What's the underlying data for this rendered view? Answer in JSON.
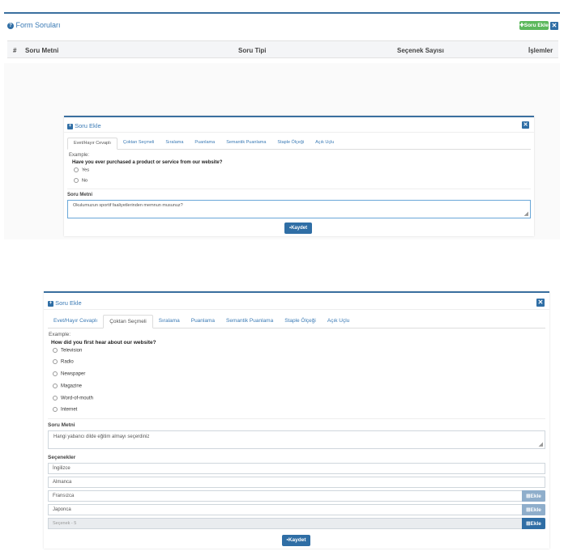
{
  "colors": {
    "accent": "#2f6ea5",
    "success": "#5cb85c",
    "panel_border": "#3a6f9f"
  },
  "form_panel": {
    "title": "Form Soruları",
    "title_icon": "question-circle-icon",
    "add_button": "Soru Ekle",
    "columns": [
      "#",
      "Soru Metni",
      "Soru Tipi",
      "Seçenek Sayısı",
      "İşlemler"
    ]
  },
  "modal1": {
    "title": "Soru Ekle",
    "tabs": [
      "Evet/Hayır Cevaplı",
      "Çoktan Seçmeli",
      "Sıralama",
      "Puanlama",
      "Semantik Puanlama",
      "Staple Ölçeği",
      "Açık Uçlu"
    ],
    "active_tab": 0,
    "example_label": "Example:",
    "example_question": "Have you ever purchased a product or service from our website?",
    "options": [
      "Yes",
      "No"
    ],
    "soru_metni_label": "Soru Metni",
    "soru_metni_value": "Okulumuzun sportif faaliyetlerinden memnun musunuz?",
    "save": "Kaydet"
  },
  "modal2": {
    "title": "Soru Ekle",
    "tabs": [
      "Evet/Hayır Cevaplı",
      "Çoktan Seçmeli",
      "Sıralama",
      "Puanlama",
      "Semantik Puanlama",
      "Staple Ölçeği",
      "Açık Uçlu"
    ],
    "active_tab": 1,
    "example_label": "Example:",
    "example_question": "How did you first hear about our website?",
    "options": [
      "Television",
      "Radio",
      "Newspaper",
      "Magazine",
      "Word-of-mouth",
      "Internet"
    ],
    "soru_metni_label": "Soru Metni",
    "soru_metni_value": "Hangi yabancı dilde eğitim almayı seçerdiniz",
    "secenekler_label": "Seçenekler",
    "secenekler": [
      "İngilizce",
      "Almanca",
      "Fransızca",
      "Japonca"
    ],
    "secenek_placeholder": "Seçenek - 5",
    "ekle": "Ekle",
    "save": "Kaydet"
  }
}
